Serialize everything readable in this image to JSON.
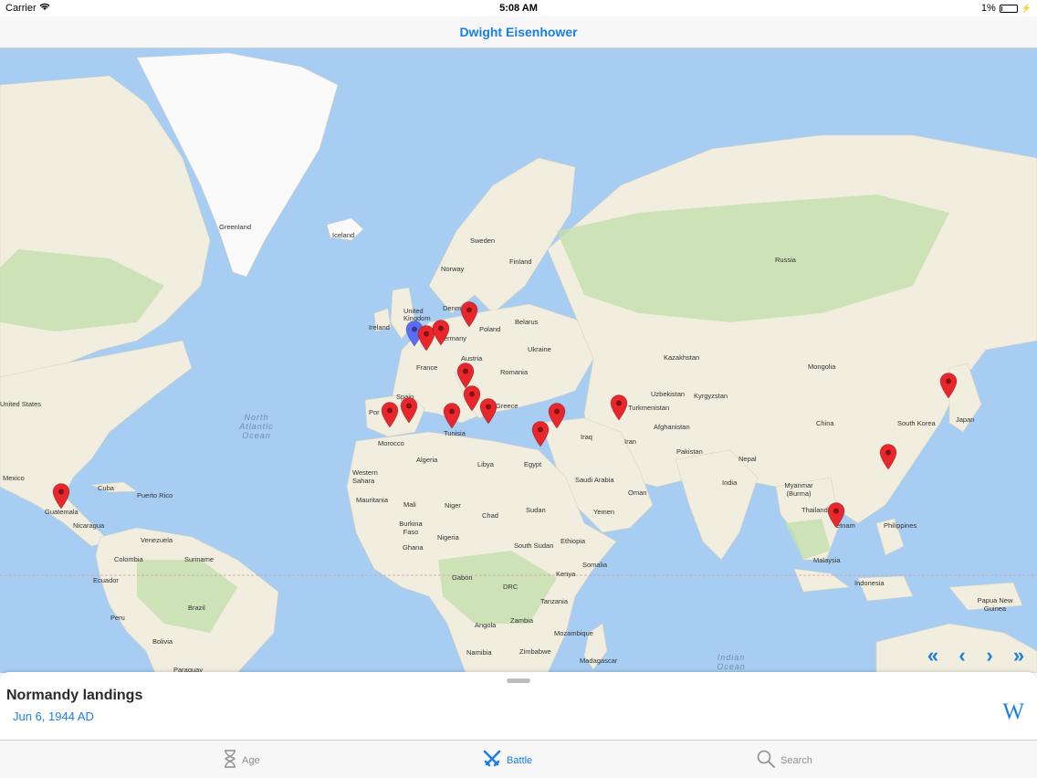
{
  "status": {
    "carrier": "Carrier",
    "time": "5:08 AM",
    "battery": "1%"
  },
  "nav": {
    "title": "Dwight Eisenhower"
  },
  "map": {
    "labels": {
      "greenland": "Greenland",
      "iceland": "Iceland",
      "sweden": "Sweden",
      "norway": "Norway",
      "finland": "Finland",
      "russia": "Russia",
      "united_kingdom": "United Kingdom",
      "ireland": "Ireland",
      "denmark": "Denm",
      "germany": "ermany",
      "poland": "Poland",
      "belarus": "Belarus",
      "ukraine": "Ukraine",
      "austria": "Austria",
      "france": "France",
      "romania": "Romania",
      "kazakhstan": "Kazakhstan",
      "mongolia": "Mongolia",
      "spain": "Spain",
      "portugal": "Por",
      "greece": "Greece",
      "turkmenistan": "Turkmenistan",
      "uzbekistan": "Uzbekistan",
      "kyrgyzstan": "Kyrgyzstan",
      "tunisia": "Tunisia",
      "morocco": "Morocco",
      "algeria": "Algeria",
      "libya": "Libya",
      "egypt": "Egypt",
      "iraq": "Iraq",
      "iran": "Iran",
      "afghanistan": "Afghanistan",
      "pakistan": "Pakistan",
      "china": "China",
      "south_korea": "South Korea",
      "japan": "Japan",
      "nepal": "Nepal",
      "india": "India",
      "saudi_arabia": "Saudi Arabia",
      "oman": "Oman",
      "yemen": "Yemen",
      "western_sahara": "Western Sahara",
      "mauritania": "Mauritania",
      "mali": "Mali",
      "niger": "Niger",
      "chad": "Chad",
      "sudan": "Sudan",
      "burkina_faso": "Burkina Faso",
      "ghana": "Ghana",
      "nigeria": "Nigeria",
      "south_sudan": "South Sudan",
      "ethiopia": "Ethiopia",
      "somalia": "Somalia",
      "kenya": "Kenya",
      "gabon": "Gabon",
      "drc": "DRC",
      "tanzania": "Tanzania",
      "angola": "Angola",
      "zambia": "Zambia",
      "mozambique": "Mozambique",
      "namibia": "Namibia",
      "zimbabwe": "Zimbabwe",
      "madagascar": "Madagascar",
      "myanmar": "Myanmar (Burma)",
      "thailand": "Thailand",
      "vietnam": "etnam",
      "philippines": "Philippines",
      "malaysia": "Malaysia",
      "indonesia": "Indonesia",
      "papua_new_guinea": "Papua New Guinea",
      "united_states": "United States",
      "mexico": "Mexico",
      "cuba": "Cuba",
      "puerto_rico": "Puerto Rico",
      "guatemala": "Guatemala",
      "nicaragua": "Nicaragua",
      "venezuela": "Venezuela",
      "colombia": "Colombia",
      "suriname": "Suriname",
      "ecuador": "Ecuador",
      "peru": "Peru",
      "brazil": "Brazil",
      "bolivia": "Bolivia",
      "paraguay": "Paraguay"
    },
    "oceans": {
      "north_atlantic": "North Atlantic Ocean",
      "indian": "Indian Ocean"
    },
    "pin_colors": {
      "selected": "#5c6cf5",
      "default": "#e8262c"
    },
    "pins": [
      {
        "id": "normandy",
        "state": "selected"
      },
      {
        "id": "europe-2",
        "state": "default"
      },
      {
        "id": "europe-3",
        "state": "default"
      },
      {
        "id": "europe-4",
        "state": "default"
      },
      {
        "id": "europe-5",
        "state": "default"
      },
      {
        "id": "italy-1",
        "state": "default"
      },
      {
        "id": "italy-2",
        "state": "default"
      },
      {
        "id": "greece-1",
        "state": "default"
      },
      {
        "id": "tunisia-1",
        "state": "default"
      },
      {
        "id": "spain-1",
        "state": "default"
      },
      {
        "id": "spain-2",
        "state": "default"
      },
      {
        "id": "israel-1",
        "state": "default"
      },
      {
        "id": "syria-1",
        "state": "default"
      },
      {
        "id": "iran-1",
        "state": "default"
      },
      {
        "id": "japan-1",
        "state": "default"
      },
      {
        "id": "taiwan-1",
        "state": "default"
      },
      {
        "id": "vietnam-1",
        "state": "default"
      },
      {
        "id": "guatemala-1",
        "state": "default"
      }
    ]
  },
  "pager": {
    "first": "«",
    "prev": "‹",
    "next": "›",
    "last": "»"
  },
  "sheet": {
    "title": "Normandy landings",
    "date": "Jun 6, 1944 AD",
    "wiki_label": "W"
  },
  "tabs": [
    {
      "label": "Age",
      "icon": "hourglass-icon"
    },
    {
      "label": "Battle",
      "icon": "crossed-swords-icon"
    },
    {
      "label": "Search",
      "icon": "magnifier-icon"
    }
  ],
  "colors": {
    "accent": "#1a7fe3",
    "ocean": "#a7cdf2",
    "land": "#f1eedf",
    "forest": "#c6dfae",
    "ice": "#fafafa"
  }
}
